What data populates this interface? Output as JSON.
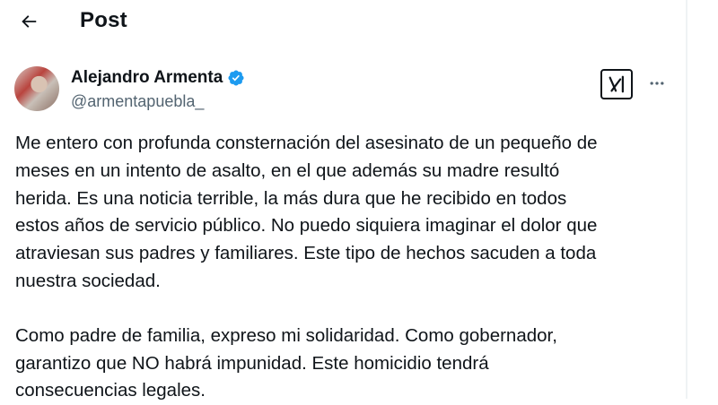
{
  "header": {
    "title": "Post",
    "back_icon": "arrow-left-icon"
  },
  "author": {
    "name": "Alejandro Armenta",
    "handle": "@armentapuebla_",
    "verified_icon": "verified-badge-icon",
    "verified_color": "#1d9bf0"
  },
  "actions": {
    "grok_icon": "grok-icon",
    "more_icon": "more-horizontal-icon"
  },
  "post": {
    "paragraph1": [
      "Me entero con profunda consternación del asesinato de un pequeño de",
      "meses en un intento de asalto, en el que además su madre resultó",
      "herida. Es una noticia terrible, la más dura que he recibido en todos",
      "estos años de servicio público. No puedo siquiera imaginar el dolor que",
      "atraviesan sus padres y familiares. Este tipo de hechos sacuden a toda",
      "nuestra sociedad."
    ],
    "paragraph2": [
      "Como padre de familia, expreso mi solidaridad. Como gobernador,",
      "garantizo que NO habrá impunidad. Este homicidio tendrá",
      "consecuencias legales."
    ]
  },
  "colors": {
    "text": "#0f1419",
    "secondary": "#536471",
    "divider": "#eff3f4"
  }
}
